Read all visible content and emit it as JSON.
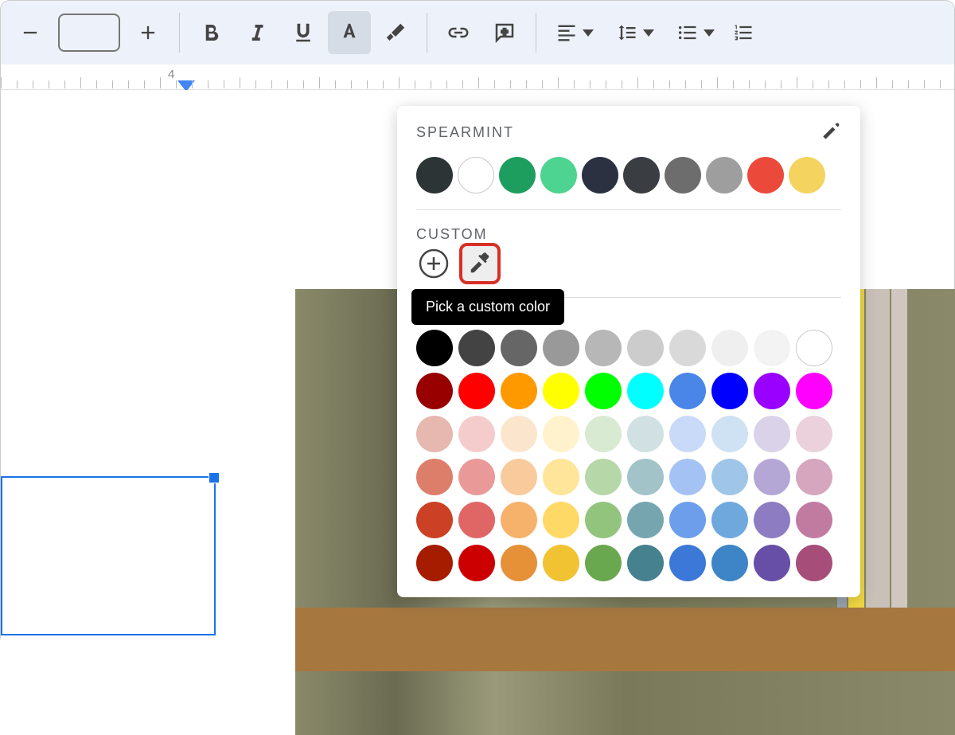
{
  "toolbar": {
    "zoom_value": ""
  },
  "ruler": {
    "marker_number": "4"
  },
  "colorPanel": {
    "theme_title": "SPEARMINT",
    "theme_colors": [
      "#2d3436",
      "#ffffff",
      "#1e9e5e",
      "#4dd490",
      "#2b3140",
      "#3a3d42",
      "#6d6d6d",
      "#9e9e9e",
      "#eb4a3b",
      "#f4d35e"
    ],
    "custom_title": "CUSTOM",
    "tooltip": "Pick a custom color",
    "standard_colors": [
      [
        "#000000",
        "#434343",
        "#666666",
        "#999999",
        "#b7b7b7",
        "#cccccc",
        "#d9d9d9",
        "#efefef",
        "#f3f3f3",
        "#ffffff"
      ],
      [
        "#980000",
        "#ff0000",
        "#ff9900",
        "#ffff00",
        "#00ff00",
        "#00ffff",
        "#4a86e8",
        "#0000ff",
        "#9900ff",
        "#ff00ff"
      ],
      [
        "#e6b8af",
        "#f4cccc",
        "#fce5cd",
        "#fff2cc",
        "#d9ead3",
        "#d0e0e3",
        "#c9daf8",
        "#cfe2f3",
        "#d9d2e9",
        "#ead1dc"
      ],
      [
        "#dd7e6b",
        "#ea9999",
        "#f9cb9c",
        "#ffe599",
        "#b6d7a8",
        "#a2c4c9",
        "#a4c2f4",
        "#9fc5e8",
        "#b4a7d6",
        "#d5a6bd"
      ],
      [
        "#cc4125",
        "#e06666",
        "#f6b26b",
        "#ffd966",
        "#93c47d",
        "#76a5af",
        "#6d9eeb",
        "#6fa8dc",
        "#8e7cc3",
        "#c27ba0"
      ],
      [
        "#a61c00",
        "#cc0000",
        "#e69138",
        "#f1c232",
        "#6aa84f",
        "#45818e",
        "#3c78d8",
        "#3d85c6",
        "#674ea7",
        "#a64d79"
      ]
    ]
  }
}
